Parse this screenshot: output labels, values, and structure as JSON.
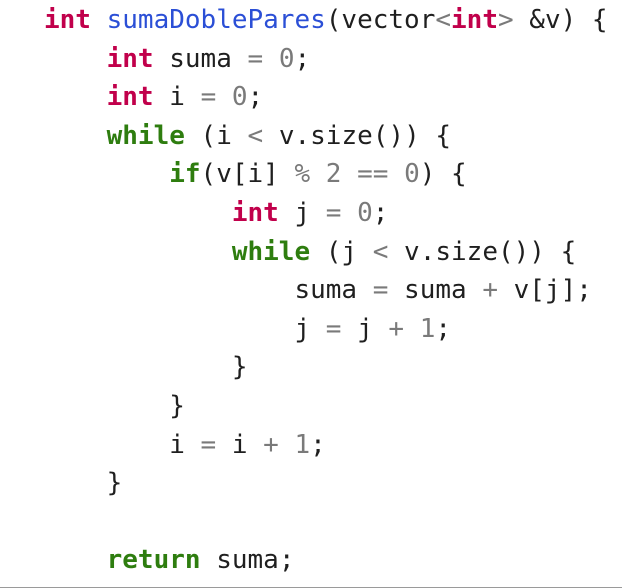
{
  "code": {
    "lines": [
      [
        {
          "t": "int",
          "c": "kw-type"
        },
        {
          "t": " "
        },
        {
          "t": "sumaDoblePares",
          "c": "fn"
        },
        {
          "t": "(vector"
        },
        {
          "t": "<",
          "c": "op"
        },
        {
          "t": "int",
          "c": "kw-type"
        },
        {
          "t": ">",
          "c": "op"
        },
        {
          "t": " &v) {"
        }
      ],
      [
        {
          "t": "    "
        },
        {
          "t": "int",
          "c": "kw-type"
        },
        {
          "t": " suma "
        },
        {
          "t": "=",
          "c": "op"
        },
        {
          "t": " "
        },
        {
          "t": "0",
          "c": "num"
        },
        {
          "t": ";"
        }
      ],
      [
        {
          "t": "    "
        },
        {
          "t": "int",
          "c": "kw-type"
        },
        {
          "t": " i "
        },
        {
          "t": "=",
          "c": "op"
        },
        {
          "t": " "
        },
        {
          "t": "0",
          "c": "num"
        },
        {
          "t": ";"
        }
      ],
      [
        {
          "t": "    "
        },
        {
          "t": "while",
          "c": "kw-ctrl"
        },
        {
          "t": " (i "
        },
        {
          "t": "<",
          "c": "op"
        },
        {
          "t": " v.size()) {"
        }
      ],
      [
        {
          "t": "        "
        },
        {
          "t": "if",
          "c": "kw-ctrl"
        },
        {
          "t": "(v[i] "
        },
        {
          "t": "%",
          "c": "op"
        },
        {
          "t": " "
        },
        {
          "t": "2",
          "c": "num"
        },
        {
          "t": " "
        },
        {
          "t": "==",
          "c": "op"
        },
        {
          "t": " "
        },
        {
          "t": "0",
          "c": "num"
        },
        {
          "t": ") {"
        }
      ],
      [
        {
          "t": "            "
        },
        {
          "t": "int",
          "c": "kw-type"
        },
        {
          "t": " j "
        },
        {
          "t": "=",
          "c": "op"
        },
        {
          "t": " "
        },
        {
          "t": "0",
          "c": "num"
        },
        {
          "t": ";"
        }
      ],
      [
        {
          "t": "            "
        },
        {
          "t": "while",
          "c": "kw-ctrl"
        },
        {
          "t": " (j "
        },
        {
          "t": "<",
          "c": "op"
        },
        {
          "t": " v.size()) {"
        }
      ],
      [
        {
          "t": "                suma "
        },
        {
          "t": "=",
          "c": "op"
        },
        {
          "t": " suma "
        },
        {
          "t": "+",
          "c": "op"
        },
        {
          "t": " v[j];"
        }
      ],
      [
        {
          "t": "                j "
        },
        {
          "t": "=",
          "c": "op"
        },
        {
          "t": " j "
        },
        {
          "t": "+",
          "c": "op"
        },
        {
          "t": " "
        },
        {
          "t": "1",
          "c": "num"
        },
        {
          "t": ";"
        }
      ],
      [
        {
          "t": "            }"
        }
      ],
      [
        {
          "t": "        }"
        }
      ],
      [
        {
          "t": "        i "
        },
        {
          "t": "=",
          "c": "op"
        },
        {
          "t": " i "
        },
        {
          "t": "+",
          "c": "op"
        },
        {
          "t": " "
        },
        {
          "t": "1",
          "c": "num"
        },
        {
          "t": ";"
        }
      ],
      [
        {
          "t": "    }"
        }
      ],
      [],
      [
        {
          "t": "    "
        },
        {
          "t": "return",
          "c": "kw-ctrl"
        },
        {
          "t": " suma;"
        }
      ]
    ]
  },
  "theme": {
    "background": "#ffffff",
    "text": "#1f1f1f",
    "type_keyword": "#c1004b",
    "control_keyword": "#2e7d0f",
    "function_name": "#2b4fd6",
    "operator_and_number": "#7a7a7a"
  }
}
